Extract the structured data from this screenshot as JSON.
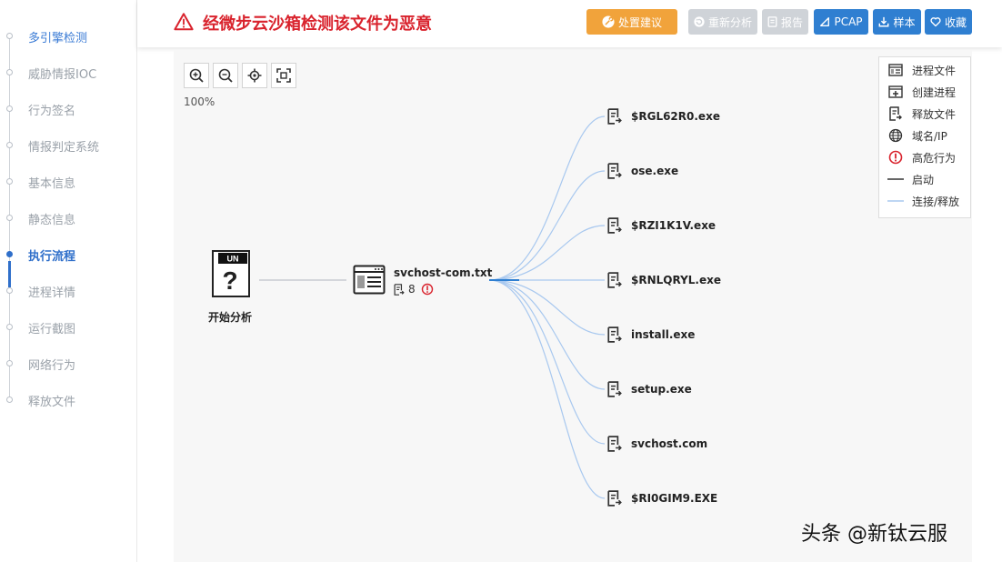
{
  "sidebar": {
    "items": [
      {
        "label": "多引擎检测"
      },
      {
        "label": "威胁情报IOC"
      },
      {
        "label": "行为签名"
      },
      {
        "label": "情报判定系统"
      },
      {
        "label": "基本信息"
      },
      {
        "label": "静态信息"
      },
      {
        "label": "执行流程"
      },
      {
        "label": "进程详情"
      },
      {
        "label": "运行截图"
      },
      {
        "label": "网络行为"
      },
      {
        "label": "释放文件"
      }
    ],
    "active": "执行流程"
  },
  "header": {
    "alert_title": "经微步云沙箱检测该文件为恶意",
    "buttons": {
      "handle": "处置建议",
      "reanalyze": "重新分析",
      "report": "报告",
      "pcap": "PCAP",
      "sample": "样本",
      "favorite": "收藏"
    }
  },
  "canvas": {
    "zoom_level": "100%",
    "legend": [
      {
        "icon": "process-file-icon",
        "label": "进程文件"
      },
      {
        "icon": "create-process-icon",
        "label": "创建进程"
      },
      {
        "icon": "release-file-icon",
        "label": "释放文件"
      },
      {
        "icon": "globe-icon",
        "label": "域名/IP"
      },
      {
        "icon": "high-risk-icon",
        "label": "高危行为"
      },
      {
        "icon": "dark-line-icon",
        "label": "启动"
      },
      {
        "icon": "light-line-icon",
        "label": "连接/释放"
      }
    ],
    "start_node": {
      "badge": "UN",
      "glyph": "?",
      "label": "开始分析"
    },
    "process_node": {
      "label": "svchost-com.txt",
      "count": "8"
    },
    "children": [
      "$RGL62R0.exe",
      "ose.exe",
      "$RZI1K1V.exe",
      "$RNLQRYL.exe",
      "install.exe",
      "setup.exe",
      "svchost.com",
      "$RI0GIM9.EXE"
    ]
  },
  "watermark": "头条 @新钛云服",
  "colors": {
    "alert_red": "#d9232d",
    "accent_blue": "#2f7fd1",
    "orange": "#f1a33b",
    "disabled_gray": "#cfd3d8",
    "edge_light_blue": "#a8c8ef"
  }
}
